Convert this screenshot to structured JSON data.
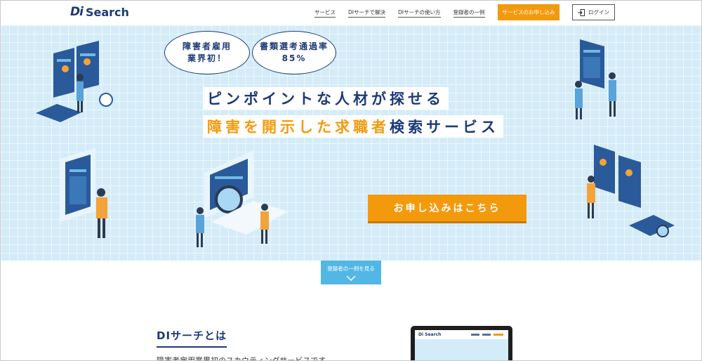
{
  "header": {
    "logo_mark": "Di",
    "logo_text": "Search",
    "nav": [
      {
        "label": "サービス"
      },
      {
        "label": "DIサーチで解決"
      },
      {
        "label": "DIサーチの使い方"
      },
      {
        "label": "登録者の一例"
      }
    ],
    "apply_label": "サービスのお申し込み",
    "login_label": "ログイン"
  },
  "hero": {
    "bubble_1": [
      "障害者雇用",
      "業界初！"
    ],
    "bubble_2": [
      "書類選考通過率",
      "85%"
    ],
    "headline_1": "ピンポイントな人材が探せる",
    "headline_2_orange": "障害を開示した求職者",
    "headline_2_rest": "検索サービス",
    "cta_label": "お申し込みはこちら"
  },
  "example_tab": {
    "label": "登録者の一例を見る"
  },
  "about": {
    "title": "DIサーチとは",
    "description": "障害者雇用業界初のスカウティングサービスです。",
    "mini_logo": "Di Search"
  },
  "colors": {
    "brand_navy": "#1d3a78",
    "accent_orange": "#f39a0c",
    "hero_bg": "#d4ecf8",
    "tab_blue": "#53b7e6"
  }
}
